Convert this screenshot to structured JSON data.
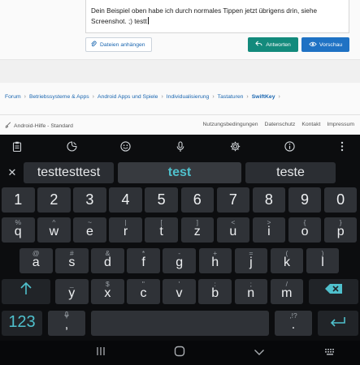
{
  "editor": {
    "text": "Dein Beispiel oben habe ich durch normales Tippen jetzt übrigens drin, siehe Screenshot. ;) testt"
  },
  "actions": {
    "attach_label": "Dateien anhängen",
    "reply_label": "Antworten",
    "preview_label": "Vorschau"
  },
  "breadcrumb": [
    "Forum",
    "Betriebssysteme & Apps",
    "Android Apps und Spiele",
    "Individualisierung",
    "Tastaturen",
    "SwiftKey"
  ],
  "footer": {
    "style_label": "Android-Hilfe - Standard",
    "links": [
      "Nutzungsbedingungen",
      "Datenschutz",
      "Kontakt",
      "Impressum"
    ]
  },
  "keyboard": {
    "toolbar_icons": [
      "clipboard-icon",
      "sticker-icon",
      "emoji-icon",
      "microphone-icon",
      "settings-icon",
      "info-icon",
      "more-icon"
    ],
    "suggestions": [
      "testtesttest",
      "test",
      "teste"
    ],
    "number_row": [
      "1",
      "2",
      "3",
      "4",
      "5",
      "6",
      "7",
      "8",
      "9",
      "0"
    ],
    "row1": [
      {
        "main": "q",
        "alt": "%"
      },
      {
        "main": "w",
        "alt": "^"
      },
      {
        "main": "e",
        "alt": "~"
      },
      {
        "main": "r",
        "alt": "|"
      },
      {
        "main": "t",
        "alt": "["
      },
      {
        "main": "z",
        "alt": "]"
      },
      {
        "main": "u",
        "alt": "<"
      },
      {
        "main": "i",
        "alt": ">"
      },
      {
        "main": "o",
        "alt": "{"
      },
      {
        "main": "p",
        "alt": "}"
      }
    ],
    "row2": [
      {
        "main": "a",
        "alt": "@"
      },
      {
        "main": "s",
        "alt": "#"
      },
      {
        "main": "d",
        "alt": "&"
      },
      {
        "main": "f",
        "alt": "*"
      },
      {
        "main": "g",
        "alt": "-"
      },
      {
        "main": "h",
        "alt": "+"
      },
      {
        "main": "j",
        "alt": "="
      },
      {
        "main": "k",
        "alt": "("
      },
      {
        "main": "l",
        "alt": ")"
      }
    ],
    "row3": [
      {
        "main": "y",
        "alt": "_"
      },
      {
        "main": "x",
        "alt": "$"
      },
      {
        "main": "c",
        "alt": "\""
      },
      {
        "main": "v",
        "alt": "'"
      },
      {
        "main": "b",
        "alt": ":"
      },
      {
        "main": "n",
        "alt": ";"
      },
      {
        "main": "m",
        "alt": "/"
      }
    ],
    "numbers_label": "123",
    "comma": ",",
    "period": ".",
    "period_alt": ",!?",
    "colors": {
      "accent": "#4fc0cc",
      "key": "#2f3237",
      "background": "#0c0d0f"
    }
  },
  "navbar": {
    "icons": [
      "recent-apps-icon",
      "home-icon",
      "back-icon",
      "keyboard-switch-icon"
    ]
  }
}
